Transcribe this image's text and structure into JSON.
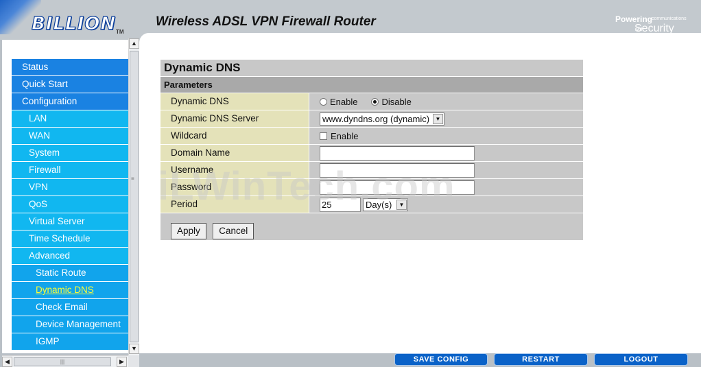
{
  "header": {
    "logo_text": "BILLION",
    "logo_tm": "TM",
    "product_title": "Wireless ADSL VPN Firewall Router",
    "tagline_powering": "Powering",
    "tagline_communications": "communications",
    "tagline_with": "with",
    "tagline_security": "Security"
  },
  "nav": {
    "items": [
      {
        "label": "Status",
        "level": 1
      },
      {
        "label": "Quick Start",
        "level": 1
      },
      {
        "label": "Configuration",
        "level": 1
      },
      {
        "label": "LAN",
        "level": 2
      },
      {
        "label": "WAN",
        "level": 2
      },
      {
        "label": "System",
        "level": 2
      },
      {
        "label": "Firewall",
        "level": 2
      },
      {
        "label": "VPN",
        "level": 2
      },
      {
        "label": "QoS",
        "level": 2
      },
      {
        "label": "Virtual Server",
        "level": 2
      },
      {
        "label": "Time Schedule",
        "level": 2
      },
      {
        "label": "Advanced",
        "level": 2
      },
      {
        "label": "Static Route",
        "level": 3
      },
      {
        "label": "Dynamic DNS",
        "level": 3,
        "active": true
      },
      {
        "label": "Check Email",
        "level": 3
      },
      {
        "label": "Device Management",
        "level": 3
      },
      {
        "label": "IGMP",
        "level": 3
      }
    ]
  },
  "page": {
    "title": "Dynamic DNS",
    "section": "Parameters",
    "fields": {
      "ddns_label": "Dynamic DNS",
      "ddns_enable": "Enable",
      "ddns_disable": "Disable",
      "ddns_selected": "Disable",
      "server_label": "Dynamic DNS Server",
      "server_value": "www.dyndns.org (dynamic)",
      "wildcard_label": "Wildcard",
      "wildcard_option": "Enable",
      "wildcard_checked": false,
      "domain_label": "Domain Name",
      "domain_value": "",
      "username_label": "Username",
      "username_value": "",
      "password_label": "Password",
      "password_value": "",
      "period_label": "Period",
      "period_value": "25",
      "period_unit": "Day(s)"
    },
    "buttons": {
      "apply": "Apply",
      "cancel": "Cancel"
    }
  },
  "watermark": "iLWinTech.com",
  "bottom_bar": {
    "save_config": "SAVE CONFIG",
    "restart": "RESTART",
    "logout": "LOGOUT"
  },
  "colors": {
    "nav_level1": "#1a82e2",
    "nav_level2": "#11b7f0",
    "nav_level3": "#11a4ec",
    "nav_active_text": "#ffff33",
    "label_bg": "#e4e2b9",
    "bottom_button": "#0a62c8"
  }
}
